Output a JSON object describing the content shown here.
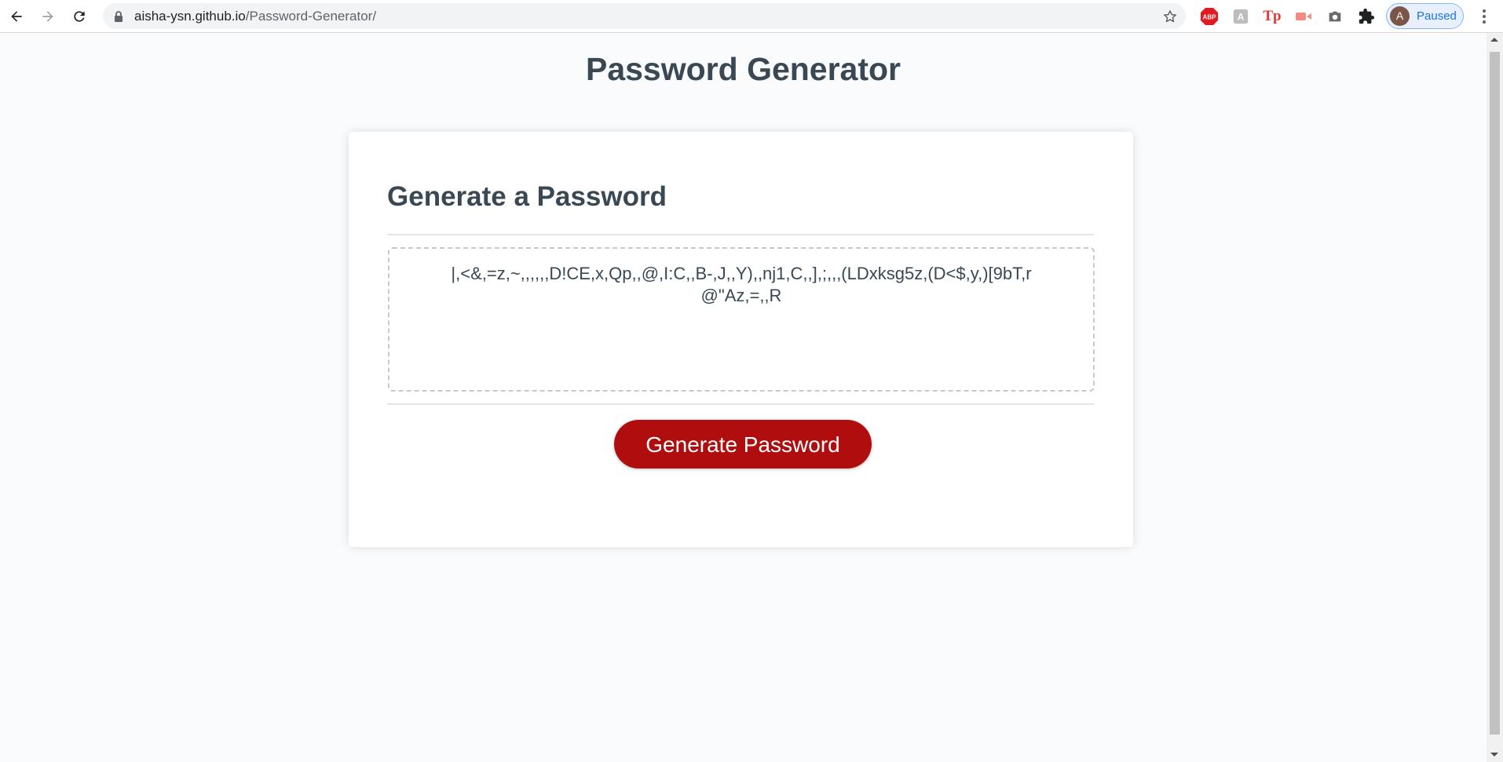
{
  "browser": {
    "url_host": "aisha-ysn.github.io",
    "url_path": "/Password-Generator/",
    "profile_initial": "A",
    "profile_status": "Paused",
    "extensions": [
      {
        "name": "adblock-plus-icon",
        "label": "ABP",
        "color": "#e11b22"
      },
      {
        "name": "translate-extension-icon",
        "label": "",
        "color": "#9e9e9e"
      },
      {
        "name": "tp-extension-icon",
        "label": "Tp",
        "color": "#e53935"
      },
      {
        "name": "video-extension-icon",
        "label": "",
        "color": "#f28b82"
      },
      {
        "name": "camera-icon",
        "label": "",
        "color": "#6b6b6b"
      },
      {
        "name": "extensions-puzzle-icon",
        "label": "",
        "color": "#202124"
      }
    ]
  },
  "page": {
    "title": "Password Generator",
    "card_title": "Generate a Password",
    "password_output": "|,<&,=z,~,,,,,,D!CE,x,Qp,,@,I:C,,B-,J,,Y),,nj1,C,,],;,,,(LDxksg5z,(D<$,y,)[9bT,r@\"Az,=,,R",
    "generate_button": "Generate Password"
  },
  "colors": {
    "button_bg": "#b00e0e",
    "heading_text": "#394853",
    "page_bg": "#f9fbfd"
  }
}
